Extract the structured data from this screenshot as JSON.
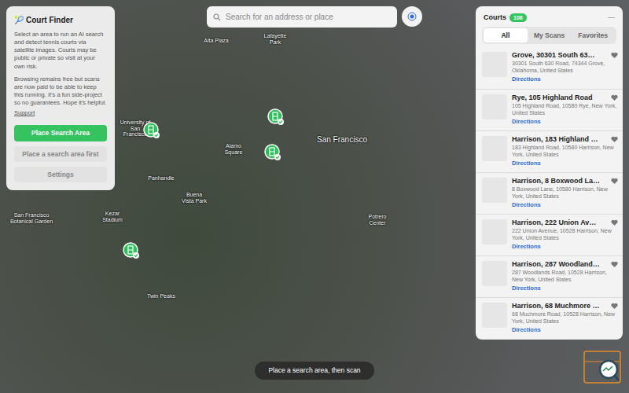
{
  "app": {
    "icon": "🎾",
    "title": "Court Finder",
    "intro": "Select an area to run an AI search and detect tennis courts via satellite images. Courts may be public or private so visit at your own risk.",
    "note": "Browsing remains free but scans are now paid to be able to keep this running. It's a fun side-project so no guarantees. Hope it's helpful.",
    "support_link": "Support",
    "buttons": [
      {
        "label": "Place Search Area",
        "disabled": false
      },
      {
        "label": "Place a search area first",
        "disabled": true
      },
      {
        "label": "Settings",
        "disabled": true
      }
    ]
  },
  "search": {
    "placeholder": "Search for an address or place"
  },
  "map": {
    "labels": [
      "Lafayette Park",
      "Alta Plaza",
      "University of San Francisco",
      "San Francisco",
      "Alamo Square",
      "Panhandle",
      "Buena Vista Park",
      "Kezar Stadium",
      "San Francisco Botanical Garden",
      "Potrero Center",
      "Twin Peaks"
    ],
    "pins": 4
  },
  "courts": {
    "title": "Courts",
    "count": "108",
    "minimize": "—",
    "tabs": [
      {
        "label": "All",
        "selected": true
      },
      {
        "label": "My Scans",
        "selected": false
      },
      {
        "label": "Favorites",
        "selected": false
      }
    ],
    "items": [
      {
        "title": "Grove, 30301 South 63…",
        "address": "30301 South 630 Road, 74344 Grove, Oklahoma, United States",
        "link": "Directions"
      },
      {
        "title": "Rye, 105 Highland Road",
        "address": "105 Highland Road, 10580 Rye, New York, United States",
        "link": "Directions"
      },
      {
        "title": "Harrison, 183 Highland …",
        "address": "183 Highland Road, 10580 Harrison, New York, United States",
        "link": "Directions"
      },
      {
        "title": "Harrison, 8 Boxwood La…",
        "address": "8 Boxwood Lane, 10580 Harrison, New York, United States",
        "link": "Directions"
      },
      {
        "title": "Harrison, 222 Union Av…",
        "address": "222 Union Avenue, 10528 Harrison, New York, United States",
        "link": "Directions"
      },
      {
        "title": "Harrison, 287 Woodland…",
        "address": "287 Woodlands Road, 10528 Harrison, New York, United States",
        "link": "Directions"
      },
      {
        "title": "Harrison, 68 Muchmore …",
        "address": "68 Muchmore Road, 10528 Harrison, New York, United States",
        "link": "Directions"
      }
    ]
  },
  "toast": "Place a search area, then scan"
}
